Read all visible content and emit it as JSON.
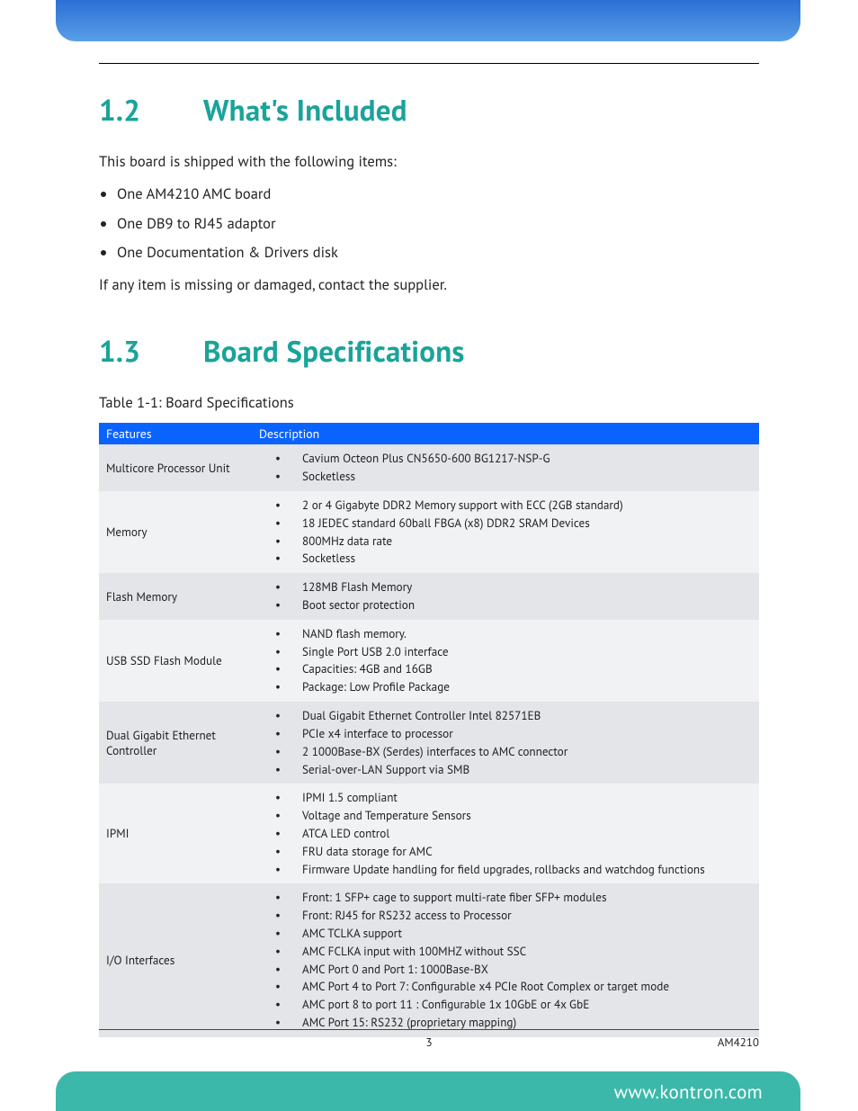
{
  "sections": {
    "s12": {
      "num": "1.2",
      "title": "What's Included"
    },
    "s13": {
      "num": "1.3",
      "title": "Board Specifications"
    }
  },
  "intro": "This board is shipped with the following items:",
  "items": {
    "i0": "One AM4210 AMC board",
    "i1": "One DB9 to RJ45 adaptor",
    "i2": "One Documentation & Drivers disk"
  },
  "closing": "If any item is missing or damaged, contact the supplier.",
  "table_title": "Table 1-1: Board Specifications",
  "table": {
    "head": {
      "c0": "Features",
      "c1": "Description"
    },
    "rows": [
      {
        "feature": "Multicore Processor Unit",
        "desc": [
          "Cavium Octeon Plus CN5650-600 BG1217-NSP-G",
          "Socketless"
        ]
      },
      {
        "feature": "Memory",
        "desc": [
          "2 or 4 Gigabyte DDR2 Memory support with ECC (2GB standard)",
          "18 JEDEC standard 60ball FBGA (x8) DDR2 SRAM Devices",
          "800MHz data rate",
          "Socketless"
        ]
      },
      {
        "feature": "Flash Memory",
        "desc": [
          "128MB Flash Memory",
          "Boot sector protection"
        ]
      },
      {
        "feature": "USB SSD Flash Module",
        "desc": [
          "NAND flash memory.",
          "Single Port USB 2.0 interface",
          "Capacities: 4GB and 16GB",
          "Package: Low Profile Package"
        ]
      },
      {
        "feature": "Dual Gigabit Ethernet Controller",
        "desc": [
          "Dual Gigabit Ethernet Controller Intel 82571EB",
          "PCIe x4 interface to processor",
          "2 1000Base-BX (Serdes) interfaces to AMC connector",
          "Serial-over-LAN Support via SMB"
        ]
      },
      {
        "feature": "IPMI",
        "desc": [
          "IPMI 1.5 compliant",
          "Voltage and Temperature Sensors",
          "ATCA LED control",
          "FRU data storage for AMC",
          "Firmware Update handling for field upgrades, rollbacks and watchdog functions"
        ]
      },
      {
        "feature": "I/O Interfaces",
        "desc": [
          "Front: 1 SFP+ cage to support multi-rate fiber SFP+ modules",
          "Front: RJ45 for RS232 access to Processor",
          "AMC TCLKA support",
          "AMC FCLKA input with 100MHZ without SSC",
          "AMC Port 0 and Port 1: 1000Base-BX",
          "AMC Port 4 to Port 7: Configurable x4 PCIe Root Complex or target mode",
          "AMC port 8 to port 11 :  Configurable 1x 10GbE or 4x GbE",
          "AMC Port 15: RS232 (proprietary mapping)"
        ]
      }
    ]
  },
  "footer": {
    "page": "3",
    "model": "AM4210",
    "url": "www.kontron.com"
  }
}
